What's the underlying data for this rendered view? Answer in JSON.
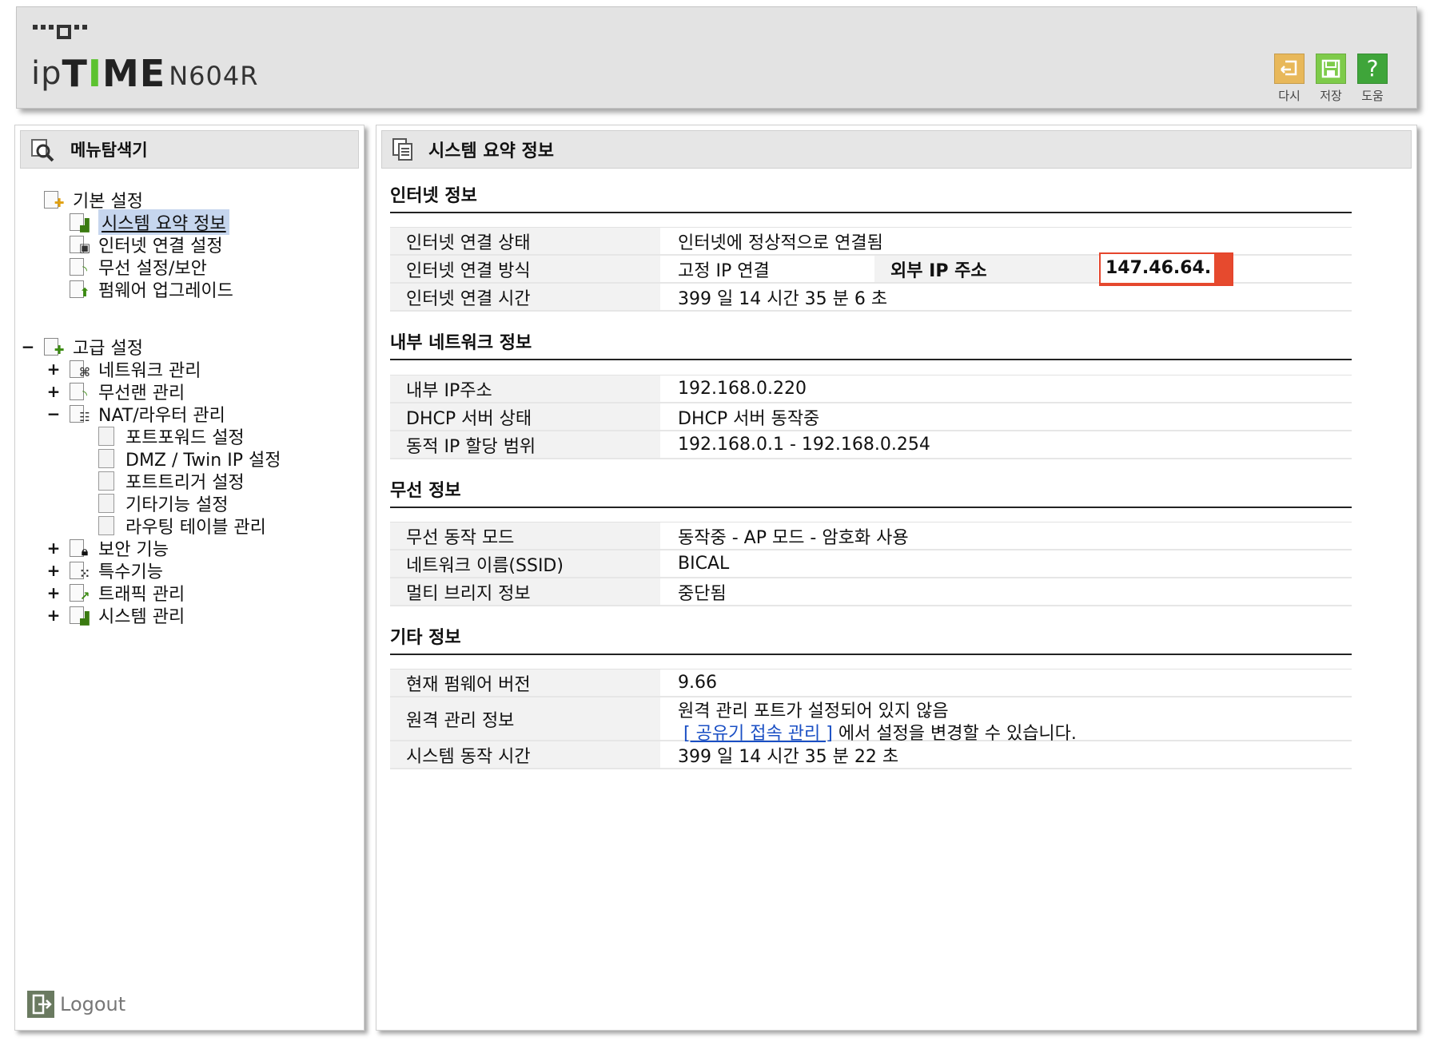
{
  "header": {
    "logo_prefix": "ip",
    "logo_t": "T",
    "logo_i": "I",
    "logo_rest": "ME",
    "model": "N604R",
    "tools": [
      {
        "label": "다시",
        "icon": "undo-icon",
        "color": "#e8b85a"
      },
      {
        "label": "저장",
        "icon": "save-icon",
        "color": "#7ecb4a"
      },
      {
        "label": "도움",
        "icon": "help-icon",
        "color": "#3fa53a"
      }
    ]
  },
  "sidebar": {
    "title": "메뉴탐색기",
    "basic": {
      "label": "기본 설정",
      "items": [
        "시스템 요약 정보",
        "인터넷 연결 설정",
        "무선 설정/보안",
        "펌웨어 업그레이드"
      ]
    },
    "advanced": {
      "expander": "−",
      "label": "고급 설정",
      "items": [
        {
          "expander": "+",
          "label": "네트워크 관리"
        },
        {
          "expander": "+",
          "label": "무선랜 관리"
        },
        {
          "expander": "−",
          "label": "NAT/라우터 관리"
        }
      ],
      "nat_children": [
        "포트포워드 설정",
        "DMZ / Twin IP 설정",
        "포트트리거 설정",
        "기타기능 설정",
        "라우팅 테이블 관리"
      ],
      "more": [
        {
          "expander": "+",
          "label": "보안 기능"
        },
        {
          "expander": "+",
          "label": "특수기능"
        },
        {
          "expander": "+",
          "label": "트래픽 관리"
        },
        {
          "expander": "+",
          "label": "시스템 관리"
        }
      ]
    },
    "logout": "Logout"
  },
  "main": {
    "title": "시스템 요약 정보",
    "internet": {
      "title": "인터넷 정보",
      "rows": [
        {
          "label": "인터넷 연결 상태",
          "value": "인터넷에 정상적으로 연결됨"
        },
        {
          "label": "인터넷 연결 방식",
          "value": "고정 IP 연결"
        },
        {
          "label": "인터넷 연결 시간",
          "value": "399 일 14 시간 35 분 6 초"
        }
      ],
      "external_ip_label": "외부 IP 주소",
      "external_ip_value": "147.46.64."
    },
    "lan": {
      "title": "내부 네트워크 정보",
      "rows": [
        {
          "label": "내부 IP주소",
          "value": "192.168.0.220"
        },
        {
          "label": "DHCP 서버 상태",
          "value": "DHCP 서버 동작중"
        },
        {
          "label": "동적 IP 할당 범위",
          "value": "192.168.0.1 -  192.168.0.254"
        }
      ]
    },
    "wireless": {
      "title": "무선 정보",
      "rows": [
        {
          "label": "무선 동작 모드",
          "value": "동작중 - AP 모드 - 암호화 사용"
        },
        {
          "label": "네트워크 이름(SSID)",
          "value": "BICAL"
        },
        {
          "label": "멀티 브리지 정보",
          "value": "중단됨"
        }
      ]
    },
    "other": {
      "title": "기타 정보",
      "rows": [
        {
          "label": "현재 펌웨어 버전",
          "value": "9.66"
        },
        {
          "label": "원격 관리 정보",
          "value": "원격 관리 포트가 설정되어 있지 않음"
        },
        {
          "label": "시스템 동작 시간",
          "value": "399 일 14 시간 35 분 22 초"
        }
      ],
      "remote_link": "[ 공유기 접속 관리 ]",
      "remote_suffix": " 에서 설정을 변경할 수 있습니다."
    }
  }
}
